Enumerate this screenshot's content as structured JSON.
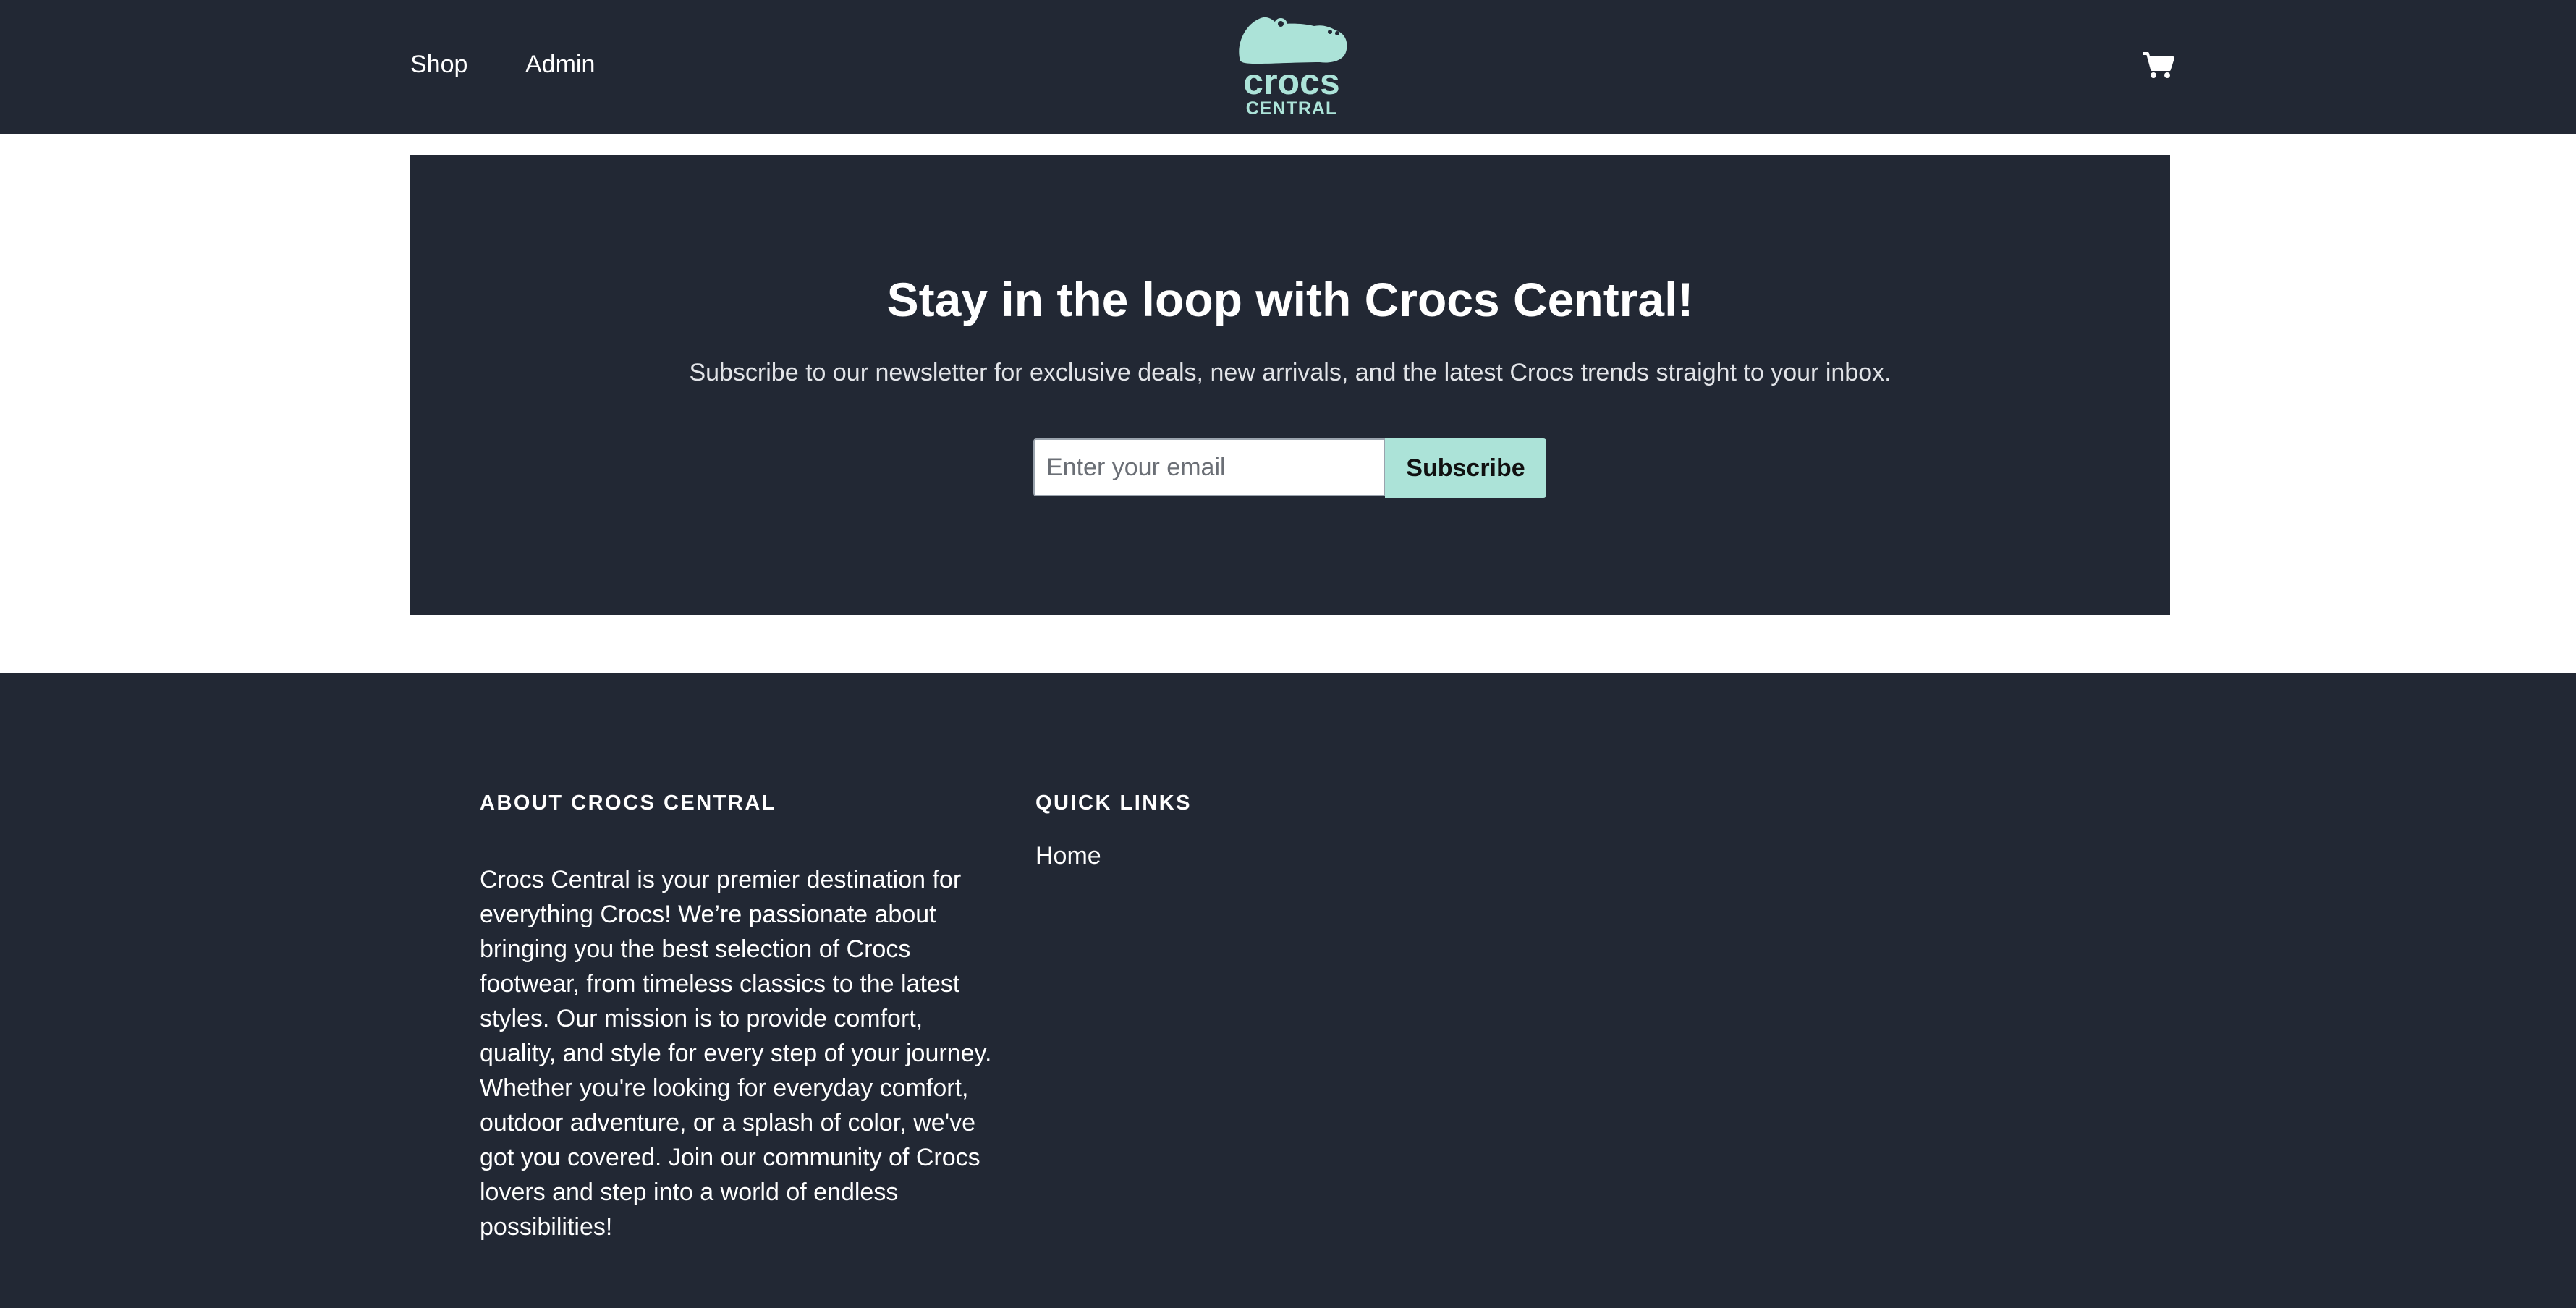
{
  "header": {
    "nav": [
      {
        "label": "Shop"
      },
      {
        "label": "Admin"
      }
    ],
    "logo": {
      "line1": "crocs",
      "line2": "CENTRAL"
    },
    "cart_icon": "shopping-cart-icon"
  },
  "newsletter": {
    "title": "Stay in the loop with Crocs Central!",
    "subtitle": "Subscribe to our newsletter for exclusive deals, new arrivals, and the latest Crocs trends straight to your inbox.",
    "email_placeholder": "Enter your email",
    "email_value": "",
    "button_label": "Subscribe"
  },
  "footer": {
    "about": {
      "heading": "ABOUT CROCS CENTRAL",
      "text": "Crocs Central is your premier destination for everything Crocs! We’re passionate about bringing you the best selection of Crocs footwear, from timeless classics to the latest styles. Our mission is to provide comfort, quality, and style for every step of your journey. Whether you're looking for everyday comfort, outdoor adventure, or a splash of color, we've got you covered. Join our community of Crocs lovers and step into a world of endless possibilities!"
    },
    "quick_links": {
      "heading": "QUICK LINKS",
      "links": [
        {
          "label": "Home"
        }
      ]
    }
  },
  "colors": {
    "dark_bg": "#222834",
    "accent": "#ace3d8",
    "page_bg": "#ffffff"
  }
}
